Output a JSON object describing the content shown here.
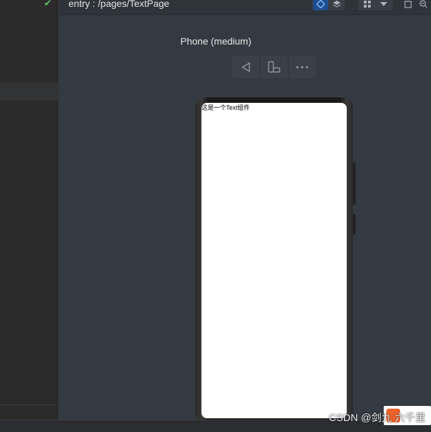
{
  "toolbar": {
    "path": "entry : /pages/TextPage",
    "icons": [
      "inspector-icon",
      "layers-icon",
      "grid-icon",
      "dropdown-icon",
      "frame-icon",
      "zoom-out-icon"
    ]
  },
  "device": {
    "label": "Phone (medium)"
  },
  "controls": {
    "icons": [
      "back-icon",
      "rotate-icon",
      "more-icon"
    ]
  },
  "screen": {
    "text": "这是一个Text组件"
  },
  "watermark": {
    "text": "CSDN @剑九 六千里"
  },
  "colors": {
    "preview_bg": "#343a42",
    "panel_bg": "#2b2b2b",
    "accent": "#1f4f8f",
    "check": "#5fb85f"
  }
}
